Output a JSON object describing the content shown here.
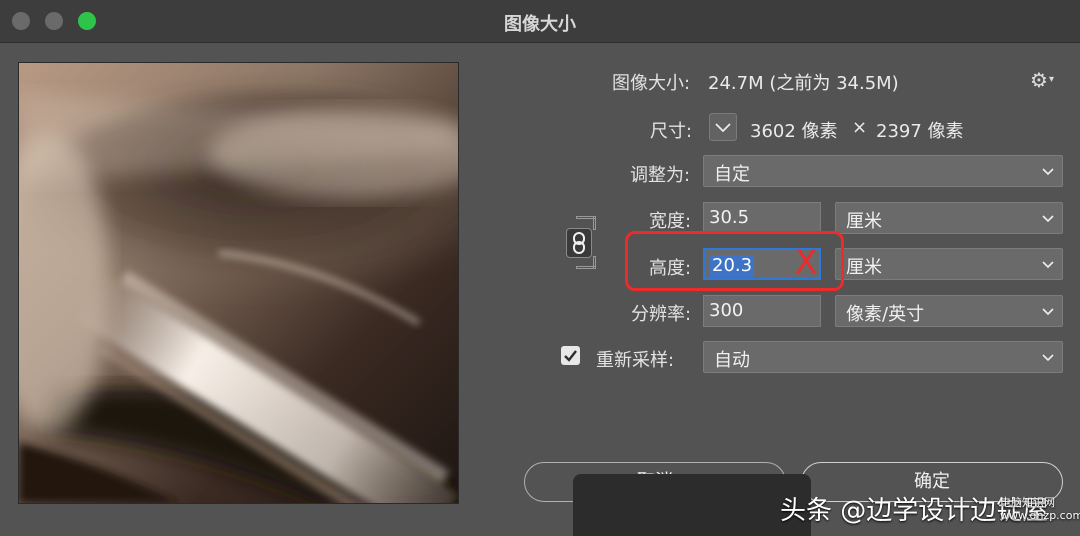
{
  "window": {
    "title": "图像大小"
  },
  "info": {
    "size_label": "图像大小:",
    "size_value": "24.7M (之前为 34.5M)",
    "dims_label": "尺寸:",
    "dims_width": "3602 像素",
    "dims_times": "×",
    "dims_height": "2397 像素"
  },
  "fit": {
    "label": "调整为:",
    "value": "自定"
  },
  "width": {
    "label": "宽度:",
    "value": "30.5",
    "unit": "厘米"
  },
  "height": {
    "label": "高度:",
    "value": "20.3",
    "unit": "厘米"
  },
  "resolution": {
    "label": "分辨率:",
    "value": "300",
    "unit": "像素/英寸"
  },
  "resample": {
    "label": "重新采样:",
    "value": "自动",
    "checked": true
  },
  "buttons": {
    "cancel": "取消",
    "ok": "确定"
  },
  "annotation": {
    "mark": "X",
    "color": "#ee2a2a"
  },
  "watermark": {
    "text": "头条 @边学设计边锭屋",
    "site_line1": "电脑知识网",
    "site_line2": "www.dnzp.com"
  },
  "icons": {
    "gear": "gear-icon",
    "link": "chain-link-icon",
    "check": "check-icon"
  },
  "colors": {
    "dialog_bg": "#535353",
    "field_bg": "#6a6a6a",
    "selection": "#3f73c6",
    "focus": "#2f78d8"
  }
}
